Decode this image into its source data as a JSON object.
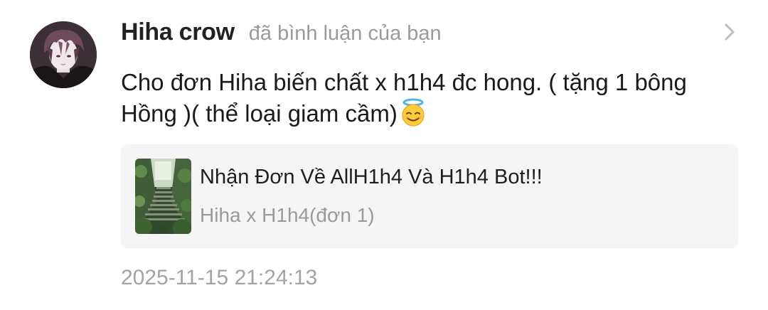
{
  "notification": {
    "username": "Hiha crow",
    "action": "đã bình luận của bạn",
    "comment": "Cho đơn Hiha biến chất x h1h4 đc hong. ( tặng 1 bông Hồng )( thể loại giam cầm)",
    "emoji": "smiling-face-with-halo",
    "timestamp": "2025-11-15 21:24:13"
  },
  "linked_post": {
    "title": "Nhận Đơn Về AllH1h4 Và H1h4 Bot!!!",
    "subtitle": "Hiha x H1h4(đơn 1)"
  },
  "colors": {
    "username": "#222222",
    "secondary_text": "#9a9a9a",
    "card_background": "#f5f5f5",
    "timestamp": "#a3a3a3"
  }
}
